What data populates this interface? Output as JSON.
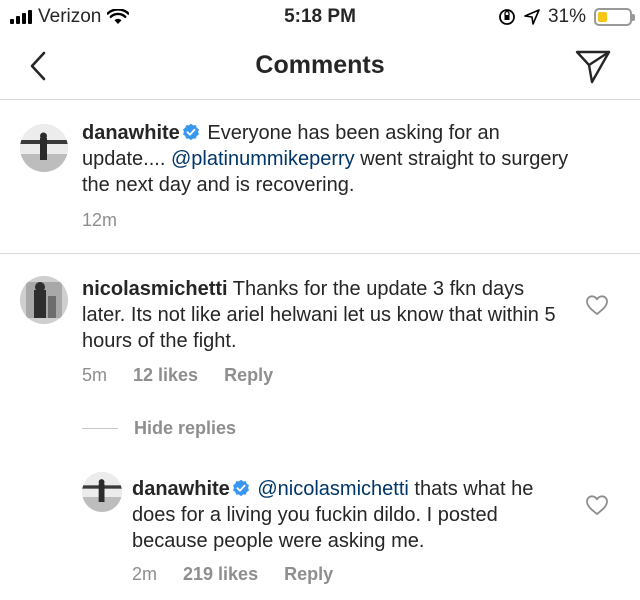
{
  "status_bar": {
    "carrier": "Verizon",
    "time": "5:18 PM",
    "battery": "31%",
    "battery_level": 0.31,
    "battery_color": "#f5c518"
  },
  "nav": {
    "title": "Comments",
    "back_icon": "chevron-left-icon",
    "send_icon": "send-icon"
  },
  "caption": {
    "username": "danawhite",
    "verified": true,
    "text_before": " Everyone has been asking for an update.... ",
    "mention": "@platinummikeperry",
    "text_after": " went straight to surgery the next day and is recovering.",
    "time": "12m"
  },
  "comments": [
    {
      "username": "nicolasmichetti",
      "text": " Thanks for the update 3 fkn days later. Its not like ariel helwani let us know that within 5 hours of the fight.",
      "time": "5m",
      "likes": "12 likes",
      "reply_label": "Reply",
      "hide_replies_label": "Hide replies",
      "replies": [
        {
          "username": "danawhite",
          "verified": true,
          "mention": "@nicolasmichetti",
          "text": " thats what he does for a living you fuckin dildo. I posted because people were asking me.",
          "time": "2m",
          "likes": "219 likes",
          "reply_label": "Reply"
        }
      ]
    }
  ],
  "colors": {
    "text": "#262626",
    "meta": "#8e8e8e",
    "mention": "#003569",
    "verified": "#3897f0",
    "divider": "#dbdbdb"
  }
}
